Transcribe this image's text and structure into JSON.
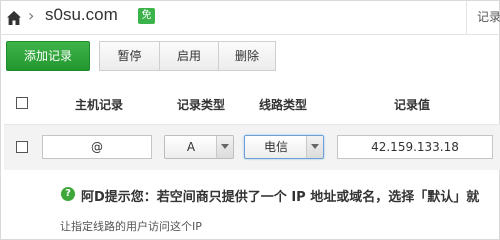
{
  "header": {
    "domain": "s0su.com",
    "free_badge": "免",
    "right_link": "记录"
  },
  "toolbar": {
    "add_label": "添加记录",
    "pause_label": "暂停",
    "enable_label": "启用",
    "delete_label": "删除"
  },
  "table": {
    "headers": {
      "host": "主机记录",
      "type": "记录类型",
      "line": "线路类型",
      "value": "记录值"
    }
  },
  "row": {
    "host_value": "@",
    "type_value": "A",
    "line_value": "电信",
    "record_value": "42.159.133.18"
  },
  "hint": {
    "icon_glyph": "?",
    "text": "阿D提示您：若空间商只提供了一个 IP 地址或域名，选择「默认」就",
    "subtext": "让指定线路的用户访问这个IP"
  },
  "colors": {
    "accent_green": "#2aa338",
    "badge_green": "#3bb34a",
    "focus_blue": "#6d9fd2"
  }
}
